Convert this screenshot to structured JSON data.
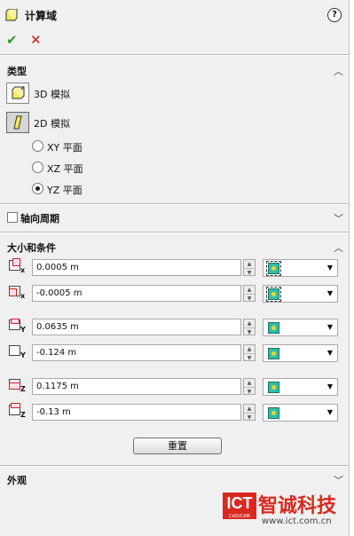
{
  "header": {
    "title": "计算域",
    "help_label": "?",
    "ok_label": "✔",
    "cancel_label": "✕"
  },
  "type_section": {
    "title": "类型",
    "options": [
      {
        "label": "3D 模拟",
        "icon": "cube-icon",
        "selected": false
      },
      {
        "label": "2D 模拟",
        "icon": "plane-icon",
        "selected": true
      }
    ],
    "planes": [
      {
        "label": "XY 平面",
        "checked": false
      },
      {
        "label": "XZ 平面",
        "checked": false
      },
      {
        "label": "YZ 平面",
        "checked": true
      }
    ]
  },
  "axial_section": {
    "title": "轴向周期",
    "checked": false
  },
  "size_section": {
    "title": "大小和条件",
    "rows": [
      {
        "axis": "x",
        "value": "0.0005 m",
        "condition_icon": "symmetry-icon"
      },
      {
        "axis": "x",
        "value": "-0.0005 m",
        "condition_icon": "symmetry-icon"
      },
      {
        "axis": "y",
        "value": "0.0635 m",
        "condition_icon": "default-icon"
      },
      {
        "axis": "y",
        "value": "-0.124 m",
        "condition_icon": "default-icon"
      },
      {
        "axis": "z",
        "value": "0.1175 m",
        "condition_icon": "default-icon"
      },
      {
        "axis": "z",
        "value": "-0.13 m",
        "condition_icon": "default-icon"
      }
    ],
    "reset_label": "重置"
  },
  "appearance_section": {
    "title": "外观"
  },
  "watermark": {
    "brand": "ICT",
    "brand_sub": "CAD/CAM",
    "name": "智诚科技",
    "url": "www.ict.com.cn"
  },
  "colors": {
    "panel": "#f0f0f0",
    "accent_ok": "#2a9a2a",
    "accent_cancel": "#d21e1e",
    "logo": "#d9281f"
  }
}
